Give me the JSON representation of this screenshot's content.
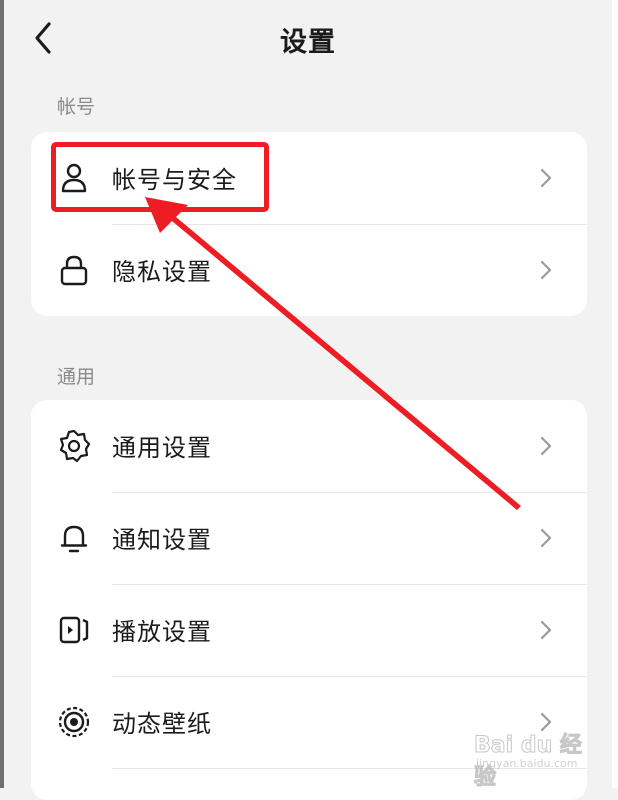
{
  "header": {
    "title": "设置"
  },
  "sections": [
    {
      "label": "帐号",
      "items": [
        {
          "label": "帐号与安全",
          "icon": "user-icon"
        },
        {
          "label": "隐私设置",
          "icon": "lock-icon"
        }
      ]
    },
    {
      "label": "通用",
      "items": [
        {
          "label": "通用设置",
          "icon": "gear-icon"
        },
        {
          "label": "通知设置",
          "icon": "bell-icon"
        },
        {
          "label": "播放设置",
          "icon": "play-icon"
        },
        {
          "label": "动态壁纸",
          "icon": "wallpaper-icon"
        }
      ]
    }
  ],
  "annotation": {
    "highlight_color": "#ee1d23"
  },
  "watermark": {
    "text": "Bai du 经验",
    "url": "jingyan.baidu.com"
  }
}
